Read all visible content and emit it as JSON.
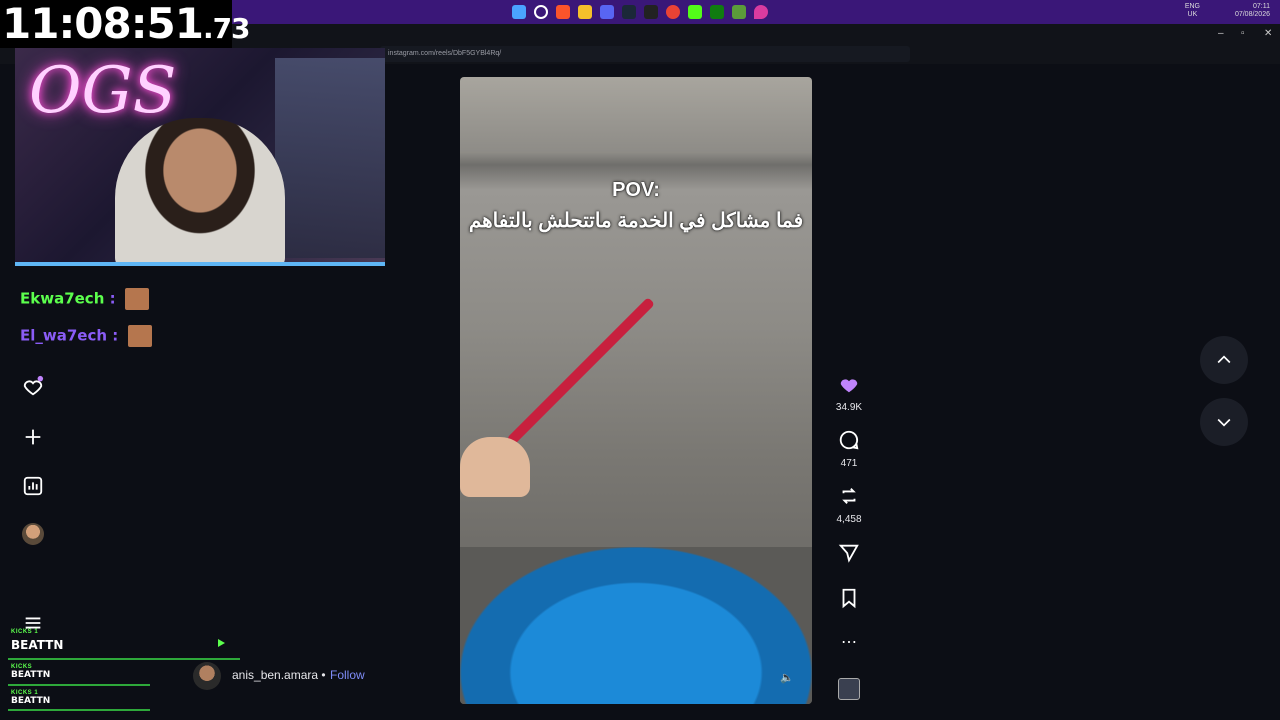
{
  "timer": {
    "main": "11:08:51",
    "fraction": ".73"
  },
  "taskbar": {
    "language_top": "ENG",
    "language_bottom": "UK",
    "clock_time": "07:11",
    "clock_date": "07/08/2026",
    "icons": [
      "windows-icon",
      "search-icon",
      "brave-icon",
      "files-icon",
      "discord-icon",
      "steam-icon",
      "epic-icon",
      "chrome-icon",
      "kick-icon",
      "xbox-icon",
      "minecraft-icon",
      "location-icon"
    ]
  },
  "browser": {
    "url": "instagram.com/reels/DbF5GYBl4Rq/",
    "accent": "#3a1778"
  },
  "chat": [
    {
      "user": "Ekwa7ech",
      "separator": ":"
    },
    {
      "user": "El_wa7ech",
      "separator": ":"
    }
  ],
  "kick_overlay": [
    {
      "label": "KICKS 1",
      "name": "BEATTN"
    },
    {
      "label": "KICKS",
      "name": "BEATTN"
    },
    {
      "label": "KICKS 1",
      "name": "BEATTN"
    }
  ],
  "reel": {
    "caption_en": "POV:",
    "caption_ar": "فما مشاكل في الخدمة ماتتحلش بالتفاهم",
    "likes": "34.9K",
    "comments": "471",
    "reposts": "4,458"
  },
  "author": {
    "name": "anis_ben.amara",
    "separator": "•",
    "follow_label": "Follow"
  },
  "colors": {
    "timer_bg": "#000000",
    "kick_green": "#5cff4d",
    "heart_filled": "#c084fc",
    "follow_link": "#7f8cf7"
  }
}
